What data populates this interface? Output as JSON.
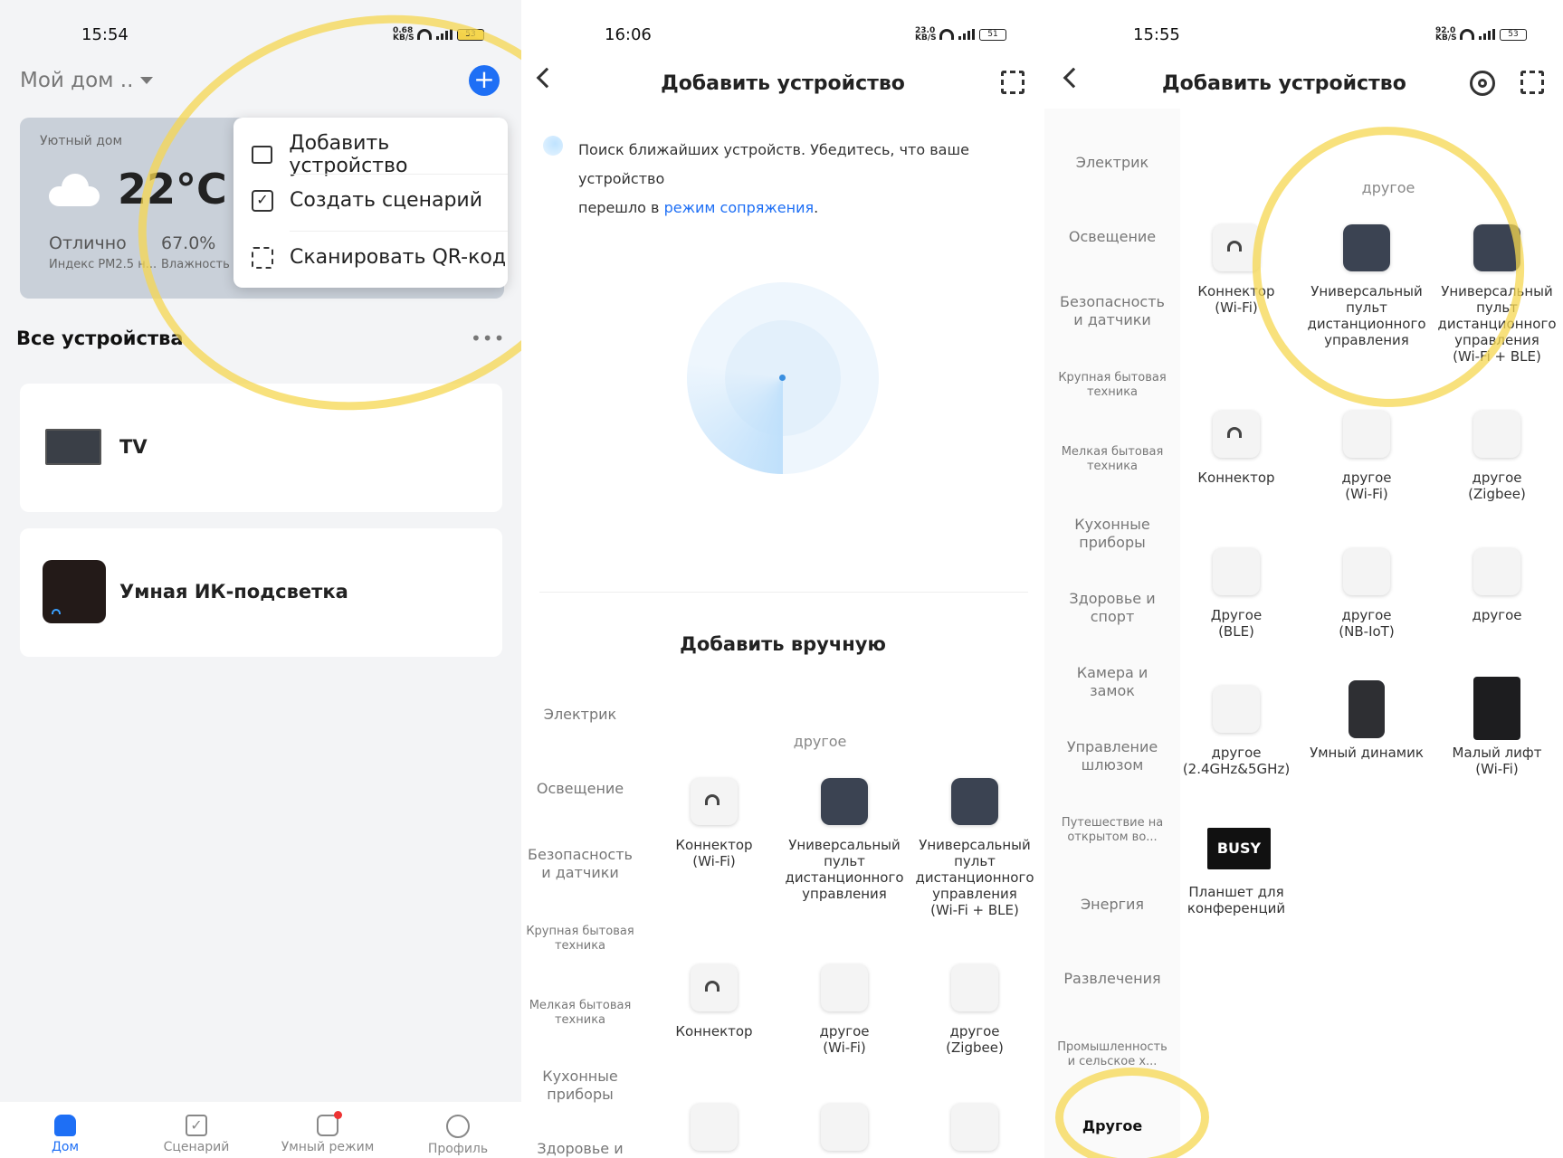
{
  "screen1": {
    "status": {
      "time": "15:54",
      "net": "0.68",
      "net_unit": "KB/S",
      "battery": "53"
    },
    "home_name": "Мой дом ..",
    "weather": {
      "location": "Уютный дом",
      "temp": "22°C",
      "air_value": "Отлично",
      "air_label": "Индекс PM2.5 н...",
      "humidity_value": "67.0%",
      "humidity_label": "Влажность"
    },
    "menu": {
      "add_device": "Добавить устройство",
      "create_scene": "Создать сценарий",
      "scan_qr": "Сканировать QR-код"
    },
    "section_title": "Все устройства",
    "devices": [
      {
        "name": "TV"
      },
      {
        "name": "Умная ИК-подсветка"
      }
    ],
    "nav": {
      "home": "Дом",
      "scenes": "Сценарий",
      "smart": "Умный режим",
      "profile": "Профиль"
    }
  },
  "screen2": {
    "status": {
      "time": "16:06",
      "net": "23.0",
      "net_unit": "KB/S",
      "battery": "51"
    },
    "title": "Добавить устройство",
    "search_text_1": "Поиск ближайших устройств. Убедитесь, что ваше устройство",
    "search_text_2a": "перешло в",
    "search_link": "режим сопряжения",
    "search_text_2b": ".",
    "manual_title": "Добавить вручную",
    "categories": [
      "Электрик",
      "Освещение",
      "Безопасность и датчики",
      "Крупная бытовая техника",
      "Мелкая бытовая техника",
      "Кухонные приборы",
      "Здоровье и"
    ],
    "group_title": "другое",
    "items": [
      {
        "line1": "Коннектор",
        "line2": "(Wi-Fi)"
      },
      {
        "line1": "Универсальный",
        "line2": "пульт",
        "line3": "дистанционного",
        "line4": "управления"
      },
      {
        "line1": "Универсальный",
        "line2": "пульт",
        "line3": "дистанционного",
        "line4": "управления",
        "line5": "(Wi-Fi + BLE)"
      },
      {
        "line1": "Коннектор"
      },
      {
        "line1": "другое",
        "line2": "(Wi-Fi)"
      },
      {
        "line1": "другое",
        "line2": "(Zigbee)"
      }
    ]
  },
  "screen3": {
    "status": {
      "time": "15:55",
      "net": "92.0",
      "net_unit": "KB/S",
      "battery": "53"
    },
    "title": "Добавить устройство",
    "categories": [
      "Электрик",
      "Освещение",
      "Безопасность и датчики",
      "Крупная бытовая техника",
      "Мелкая бытовая техника",
      "Кухонные приборы",
      "Здоровье и спорт",
      "Камера и замок",
      "Управление шлюзом",
      "Путешествие на открытом во...",
      "Энергия",
      "Развлечения",
      "Промышленность и сельское х...",
      "Другое"
    ],
    "group_title": "другое",
    "items": [
      {
        "line1": "Коннектор",
        "line2": "(Wi-Fi)"
      },
      {
        "line1": "Универсальный",
        "line2": "пульт",
        "line3": "дистанционного",
        "line4": "управления"
      },
      {
        "line1": "Универсальный",
        "line2": "пульт",
        "line3": "дистанционного",
        "line4": "управления",
        "line5": "(Wi-Fi + BLE)"
      },
      {
        "line1": "Коннектор"
      },
      {
        "line1": "другое",
        "line2": "(Wi-Fi)"
      },
      {
        "line1": "другое",
        "line2": "(Zigbee)"
      },
      {
        "line1": "Другое",
        "line2": "(BLE)"
      },
      {
        "line1": "другое",
        "line2": "(NB-IoT)"
      },
      {
        "line1": "другое"
      },
      {
        "line1": "другое",
        "line2": "(2.4GHz&5GHz)"
      },
      {
        "line1": "Умный динамик"
      },
      {
        "line1": "Малый лифт",
        "line2": "(Wi-Fi)"
      },
      {
        "line1": "Планшет для",
        "line2": "конференций"
      }
    ],
    "busy_label": "BUSY"
  },
  "colors": {
    "accent": "#1e6ff5",
    "annotation": "#f5d750",
    "tile_dark": "#3b4352"
  }
}
